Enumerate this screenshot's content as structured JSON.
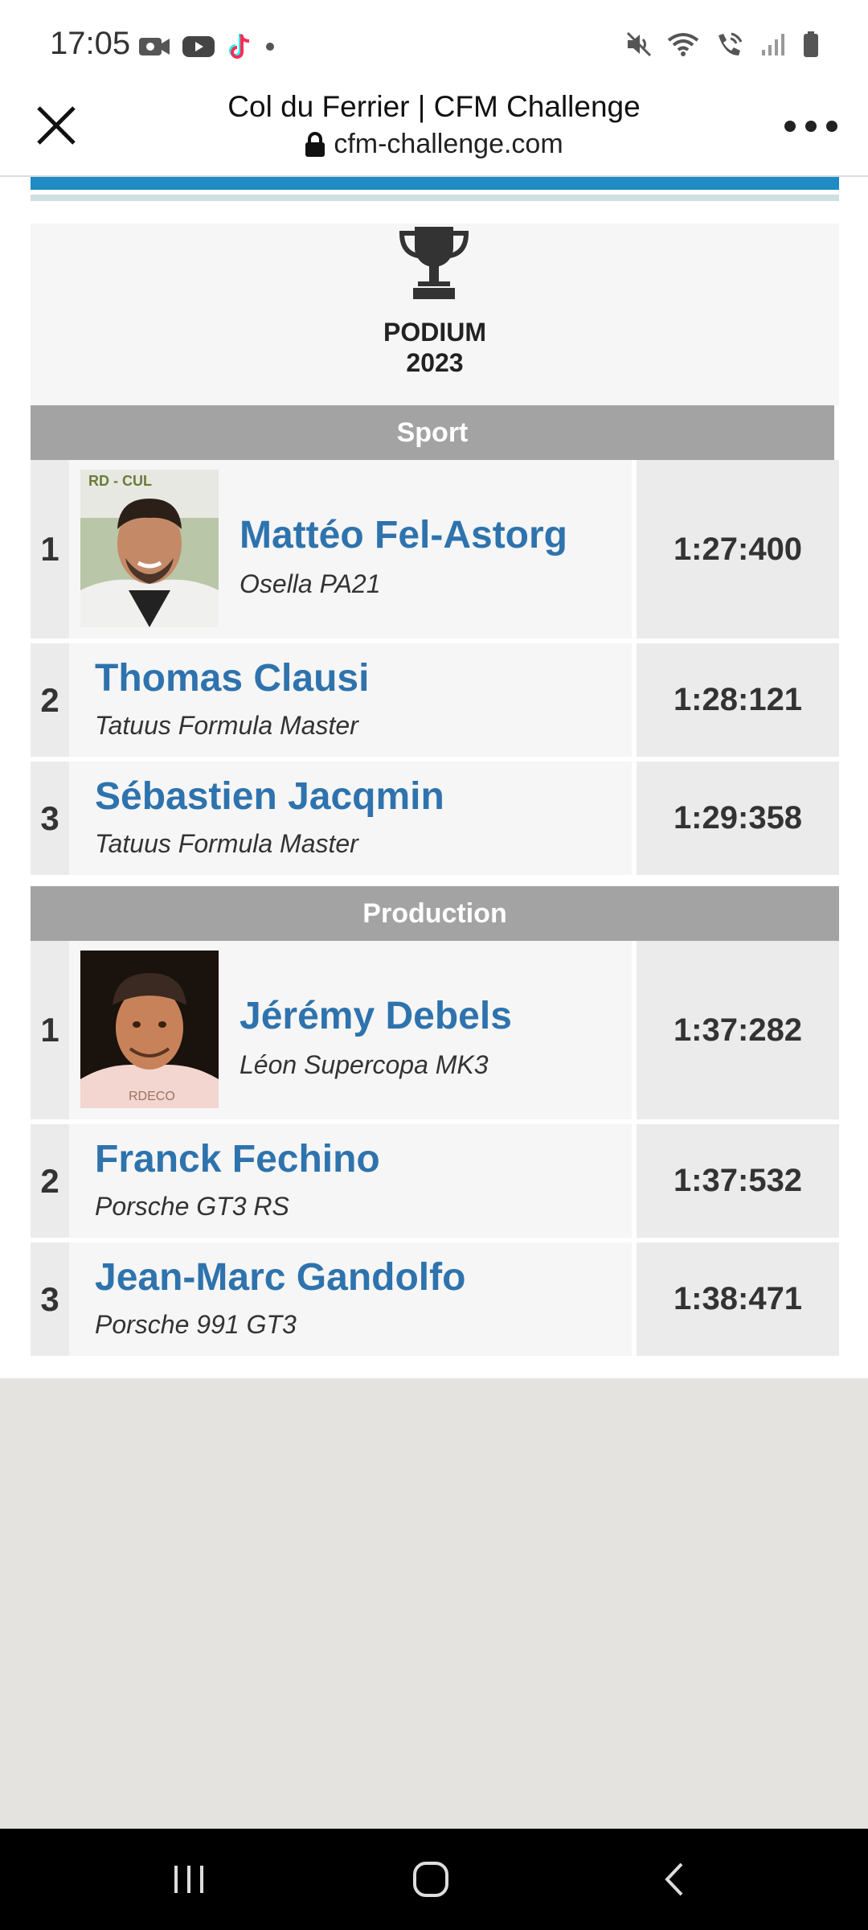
{
  "status_bar": {
    "time": "17:05",
    "left_icons": [
      "video-call-icon",
      "youtube-icon",
      "tiktok-icon",
      "dot-icon"
    ],
    "right_icons": [
      "mute-icon",
      "wifi-icon",
      "wifi-calling-icon",
      "signal-icon",
      "battery-icon"
    ]
  },
  "browser": {
    "title": "Col du Ferrier | CFM Challenge",
    "url": "cfm-challenge.com"
  },
  "podium": {
    "title_line1": "PODIUM",
    "title_line2": "2023"
  },
  "sections": [
    {
      "name": "Sport",
      "rows": [
        {
          "rank": "1",
          "driver": "Mattéo Fel-Astorg",
          "car": "Osella PA21",
          "time": "1:27:400",
          "has_photo": true
        },
        {
          "rank": "2",
          "driver": "Thomas Clausi",
          "car": "Tatuus Formula Master",
          "time": "1:28:121",
          "has_photo": false
        },
        {
          "rank": "3",
          "driver": "Sébastien Jacqmin",
          "car": "Tatuus Formula Master",
          "time": "1:29:358",
          "has_photo": false
        }
      ]
    },
    {
      "name": "Production",
      "rows": [
        {
          "rank": "1",
          "driver": "Jérémy Debels",
          "car": "Léon Supercopa MK3",
          "time": "1:37:282",
          "has_photo": true
        },
        {
          "rank": "2",
          "driver": "Franck Fechino",
          "car": "Porsche GT3 RS",
          "time": "1:37:532",
          "has_photo": false
        },
        {
          "rank": "3",
          "driver": "Jean-Marc Gandolfo",
          "car": "Porsche 991 GT3",
          "time": "1:38:471",
          "has_photo": false
        }
      ]
    }
  ],
  "colors": {
    "accent_blue": "#1e8bc3",
    "driver_name": "#2e73ad",
    "section_header": "#a3a3a3"
  }
}
